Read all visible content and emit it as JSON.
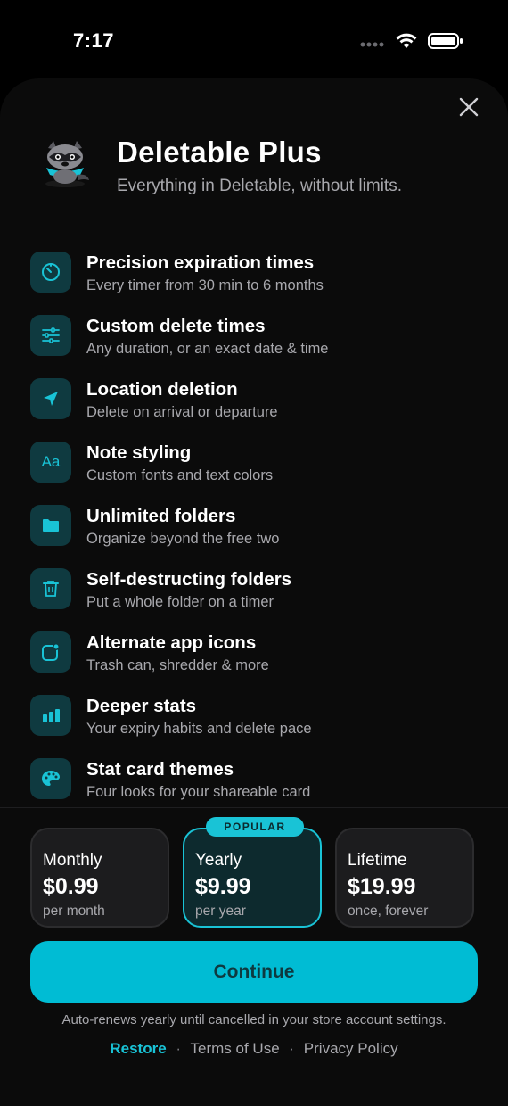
{
  "status_bar": {
    "time": "7:17"
  },
  "header": {
    "title": "Deletable Plus",
    "subtitle": "Everything in Deletable, without limits."
  },
  "features": [
    {
      "icon": "timer-icon",
      "title": "Precision expiration times",
      "subtitle": "Every timer from 30 min to 6 months"
    },
    {
      "icon": "sliders-icon",
      "title": "Custom delete times",
      "subtitle": "Any duration, or an exact date & time"
    },
    {
      "icon": "location-arrow-icon",
      "title": "Location deletion",
      "subtitle": "Delete on arrival or departure"
    },
    {
      "icon": "text-style-icon",
      "title": "Note styling",
      "subtitle": "Custom fonts and text colors"
    },
    {
      "icon": "folder-icon",
      "title": "Unlimited folders",
      "subtitle": "Organize beyond the free two"
    },
    {
      "icon": "trash-icon",
      "title": "Self-destructing folders",
      "subtitle": "Put a whole folder on a timer"
    },
    {
      "icon": "app-icon-badge-icon",
      "title": "Alternate app icons",
      "subtitle": "Trash can, shredder & more"
    },
    {
      "icon": "bar-chart-icon",
      "title": "Deeper stats",
      "subtitle": "Your expiry habits and delete pace"
    },
    {
      "icon": "palette-icon",
      "title": "Stat card themes",
      "subtitle": "Four looks for your shareable card"
    }
  ],
  "feature_icon_text": "Aa",
  "plans": [
    {
      "name": "Monthly",
      "price": "$0.99",
      "period": "per month"
    },
    {
      "name": "Yearly",
      "price": "$9.99",
      "period": "per year",
      "badge": "POPULAR"
    },
    {
      "name": "Lifetime",
      "price": "$19.99",
      "period": "once, forever"
    }
  ],
  "continue_label": "Continue",
  "disclaimer": "Auto-renews yearly until cancelled in your store account settings.",
  "links": {
    "restore": "Restore",
    "terms": "Terms of Use",
    "privacy": "Privacy Policy",
    "separator": "·"
  },
  "colors": {
    "accent": "#19c3d6",
    "button": "#00bcd4",
    "background": "#0b0b0b",
    "icon_bg": "#0f3a40",
    "muted_text": "#a8a8ad"
  }
}
